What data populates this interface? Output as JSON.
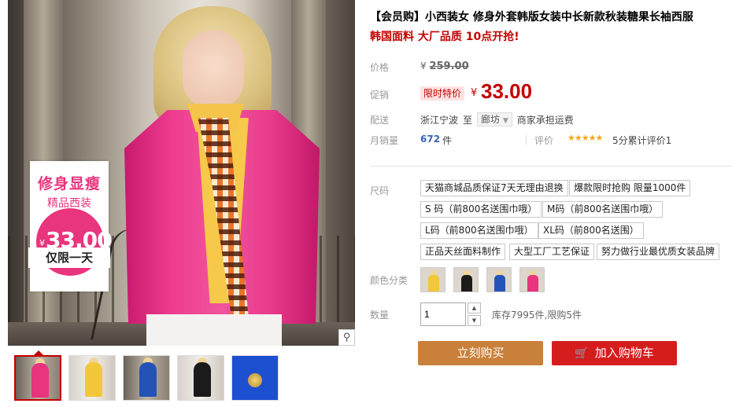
{
  "gallery": {
    "promo": {
      "title": "修身显瘦",
      "subtitle": "精品西装",
      "yen": "¥",
      "price": "33.00",
      "band": "仅限一天"
    },
    "zoom_icon": "magnifier-icon",
    "thumbnails": [
      "pink-blazer",
      "yellow-blazer",
      "blue-blazer",
      "black-blazer",
      "blue-button-closeup"
    ]
  },
  "product": {
    "title": "【会员购】小西装女 修身外套韩版女装中长新款秋装糖果长袖西服",
    "subtitle": "韩国面料 大厂品质 10点开抢!",
    "price_label": "价格",
    "original_price_currency": "¥",
    "original_price": "259.00",
    "promo_label": "促销",
    "limit_tag": "限时特价",
    "price_currency": "¥",
    "price": "33.00",
    "shipping": {
      "label": "配送",
      "origin": "浙江宁波",
      "to": "至",
      "destination": "廊坊",
      "note": "商家承担运费"
    },
    "sales": {
      "label": "月销量",
      "count": "672",
      "unit": "件",
      "rating_label": "评价",
      "stars": "★★★★★",
      "rating_text": "5分累计评价1"
    },
    "size_label": "尺码",
    "sizes": [
      "天猫商城品质保证7天无理由退换",
      "爆款限时抢购 限量1000件",
      "S 码（前800名送围巾哦）",
      "M码（前800名送围巾哦）",
      "L码（前800名送围巾哦）",
      "XL码（前800名送围）",
      "正品天丝面料制作",
      "大型工厂工艺保证",
      "努力做行业最优质女装品牌"
    ],
    "color_label": "颜色分类",
    "colors": [
      "yellow",
      "black",
      "blue",
      "pink"
    ],
    "quantity_label": "数量",
    "quantity_value": "1",
    "stock_text": "库存7995件,限购5件",
    "buy_now": "立刻购买",
    "add_cart": "加入购物车",
    "accent": "#c40000",
    "buy_color": "#c9803a",
    "cart_color": "#d61d1d"
  }
}
